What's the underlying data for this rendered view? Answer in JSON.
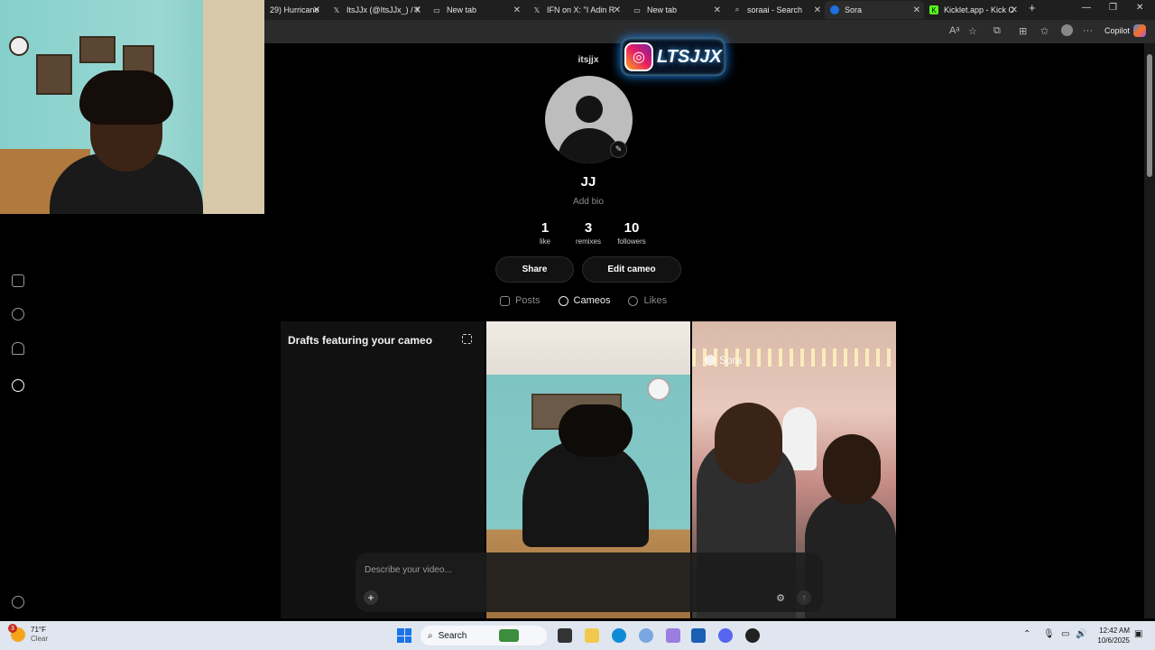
{
  "browser": {
    "tabs": [
      {
        "label": "29) Hurricane",
        "icon": "x-icon"
      },
      {
        "label": "ItsJJx (@ItsJJx_) / X",
        "icon": "x-icon"
      },
      {
        "label": "New tab",
        "icon": "tab-icon"
      },
      {
        "label": "IFN on X: \"I Adin R",
        "icon": "x-icon"
      },
      {
        "label": "New tab",
        "icon": "tab-icon"
      },
      {
        "label": "soraai - Search",
        "icon": "search-icon"
      },
      {
        "label": "Sora",
        "icon": "sora-icon"
      },
      {
        "label": "Kicklet.app - Kick C",
        "icon": "kick-icon"
      }
    ],
    "copilot_label": "Copilot"
  },
  "profile": {
    "username": "itsjjx",
    "display_name": "JJ",
    "bio_placeholder": "Add bio",
    "overlay_handle": "LTSJJX",
    "stats": [
      {
        "value": "1",
        "label": "like"
      },
      {
        "value": "3",
        "label": "remixes"
      },
      {
        "value": "10",
        "label": "followers"
      }
    ],
    "share_label": "Share",
    "edit_label": "Edit cameo",
    "tabs": [
      {
        "label": "Posts",
        "active": false
      },
      {
        "label": "Cameos",
        "active": true
      },
      {
        "label": "Likes",
        "active": false
      }
    ]
  },
  "grid": {
    "drafts_title": "Drafts featuring your cameo",
    "watermark": "Sora"
  },
  "composer": {
    "placeholder": "Describe your video..."
  },
  "taskbar": {
    "weather_temp": "71°F",
    "weather_cond": "Clear",
    "weather_badge": "3",
    "search_label": "Search",
    "time": "12:42 AM",
    "date": "10/6/2025"
  },
  "colors": {
    "background": "#000000",
    "card": "#111111",
    "muted_text": "#8a8a8a",
    "taskbar": "#dfe6ef"
  }
}
